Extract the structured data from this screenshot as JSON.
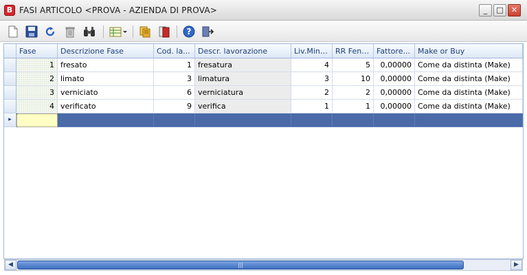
{
  "window": {
    "title": "FASI ARTICOLO <PROVA - AZIENDA DI PROVA>",
    "app_icon_letter": "B",
    "min_glyph": "_",
    "max_glyph": "□",
    "close_glyph": "✕"
  },
  "toolbar": {
    "buttons": [
      "new-document",
      "save",
      "undo",
      "delete",
      "find",
      "layout",
      "copy",
      "book",
      "help",
      "exit"
    ]
  },
  "grid": {
    "columns": [
      "Fase",
      "Descrizione Fase",
      "Cod. la...",
      "Descr. lavorazione",
      "Liv.Min.DB",
      "RR Fence",
      "Fattore...",
      "Make or Buy"
    ],
    "rows": [
      {
        "fase": "1",
        "descrizione": "fresato",
        "cod": "1",
        "descr_lav": "fresatura",
        "liv": "4",
        "rr": "5",
        "fattore": "0,00000",
        "make": "Come da distinta (Make)"
      },
      {
        "fase": "2",
        "descrizione": "limato",
        "cod": "3",
        "descr_lav": "limatura",
        "liv": "3",
        "rr": "10",
        "fattore": "0,00000",
        "make": "Come da distinta (Make)"
      },
      {
        "fase": "3",
        "descrizione": "verniciato",
        "cod": "6",
        "descr_lav": "verniciatura",
        "liv": "2",
        "rr": "2",
        "fattore": "0,00000",
        "make": "Come da distinta (Make)"
      },
      {
        "fase": "4",
        "descrizione": "verificato",
        "cod": "9",
        "descr_lav": "verifica",
        "liv": "1",
        "rr": "1",
        "fattore": "0,00000",
        "make": "Come da distinta (Make)"
      }
    ],
    "new_row_indicator": "▸"
  },
  "scrollbar": {
    "left_arrow": "◀",
    "right_arrow": "▶",
    "grip": "|||"
  },
  "colors": {
    "selected_row": "#4a6aa8",
    "accent": "#1f3f77"
  }
}
